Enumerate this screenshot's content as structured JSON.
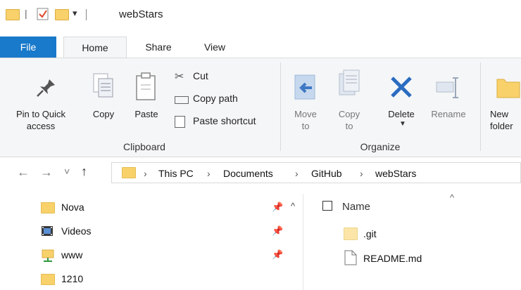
{
  "titlebar": {
    "title": "webStars",
    "qat_separator": "|",
    "dropdown_glyph": "▾"
  },
  "tabs": [
    {
      "label": "File"
    },
    {
      "label": "Home"
    },
    {
      "label": "Share"
    },
    {
      "label": "View"
    }
  ],
  "ribbon": {
    "clipboard": {
      "pin_label": "Pin to Quick access",
      "pin_line1": "Pin to Quick",
      "pin_line2": "access",
      "copy": "Copy",
      "paste": "Paste",
      "cut": "Cut",
      "copy_path": "Copy path",
      "paste_shortcut": "Paste shortcut",
      "group_label": "Clipboard"
    },
    "organize": {
      "move_line1": "Move",
      "move_line2": "to",
      "copy_line1": "Copy",
      "copy_line2": "to",
      "delete": "Delete",
      "rename": "Rename",
      "group_label": "Organize"
    },
    "new": {
      "line1": "New",
      "line2": "folder"
    }
  },
  "nav": {
    "back": "←",
    "forward": "→",
    "recent": "˅",
    "up": "↑"
  },
  "address": {
    "chevron": "›",
    "crumbs": [
      "This PC",
      "Documents",
      "GitHub",
      "webStars"
    ]
  },
  "tree": {
    "items": [
      {
        "label": "Nova",
        "pinned": true
      },
      {
        "label": "Videos",
        "pinned": true
      },
      {
        "label": "www",
        "pinned": true
      },
      {
        "label": "1210",
        "pinned": false
      }
    ],
    "scroll_up": "^"
  },
  "files": {
    "header_name": "Name",
    "sort_glyph": "^",
    "items": [
      {
        "name": ".git",
        "type": "folder"
      },
      {
        "name": "README.md",
        "type": "file"
      }
    ]
  },
  "colors": {
    "file_tab": "#1979ca",
    "ribbon_bg": "#f5f6f7",
    "folder": "#f8d16b",
    "delete_x": "#2a6cc0"
  }
}
